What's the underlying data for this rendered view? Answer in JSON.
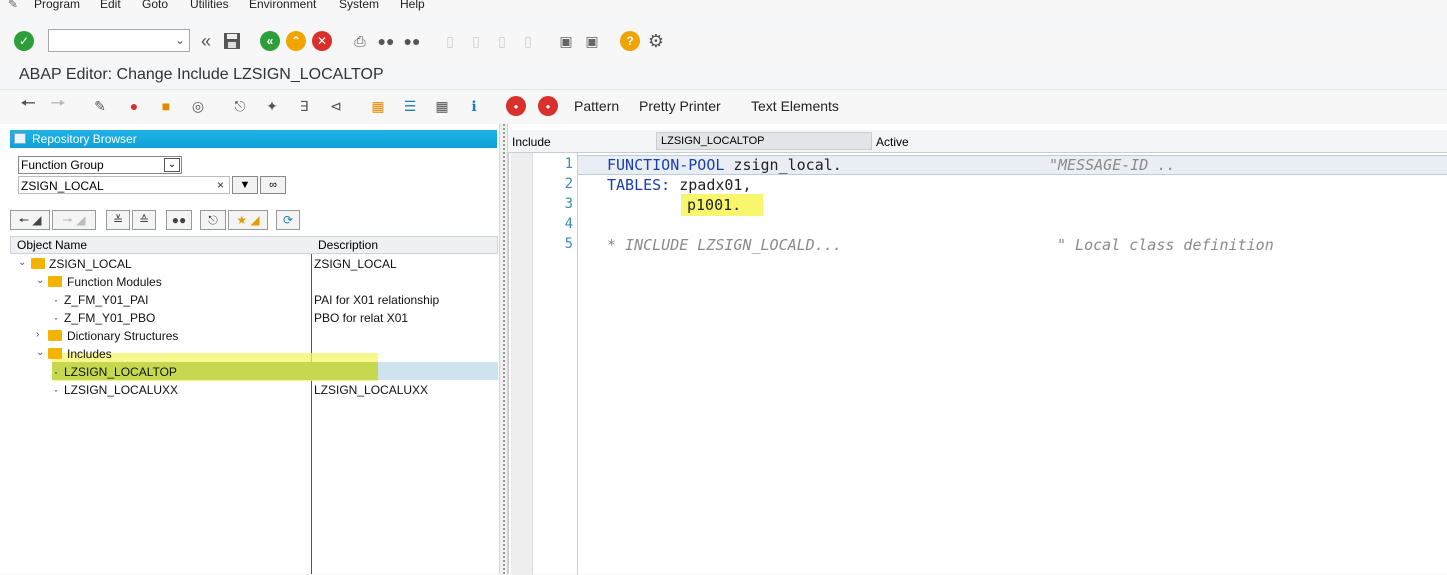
{
  "menu": {
    "items": [
      "Program",
      "Edit",
      "Goto",
      "Utilities",
      "Environment",
      "System",
      "Help"
    ]
  },
  "standard_toolbar": {
    "command_field": {
      "value": "",
      "placeholder": ""
    },
    "icons": [
      "enter-icon",
      "back-icon",
      "save-icon",
      "exit-icon",
      "up-icon",
      "cancel-icon",
      "print-icon",
      "find-icon",
      "find-next-icon",
      "first-page-icon",
      "prev-page-icon",
      "next-page-icon",
      "last-page-icon",
      "new-session-icon",
      "shortcut-icon",
      "help-icon",
      "settings-icon"
    ]
  },
  "title": "ABAP Editor: Change Include LZSIGN_LOCALTOP",
  "app_toolbar": {
    "pattern_label": "Pattern",
    "pretty_printer_label": "Pretty Printer",
    "text_elements_label": "Text Elements"
  },
  "repository": {
    "header": "Repository Browser",
    "object_type": "Function Group",
    "object_name": "ZSIGN_LOCAL",
    "clear_symbol": "×",
    "columns": {
      "name": "Object Name",
      "description": "Description"
    },
    "tree": [
      {
        "name": "ZSIGN_LOCAL",
        "desc": "ZSIGN_LOCAL",
        "level": 0,
        "type": "folder",
        "expanded": true
      },
      {
        "name": "Function Modules",
        "desc": "",
        "level": 1,
        "type": "folder",
        "expanded": true
      },
      {
        "name": "Z_FM_Y01_PAI",
        "desc": "PAI for X01 relationship",
        "level": 2,
        "type": "leaf"
      },
      {
        "name": "Z_FM_Y01_PBO",
        "desc": "PBO for relat X01",
        "level": 2,
        "type": "leaf"
      },
      {
        "name": "Dictionary Structures",
        "desc": "",
        "level": 1,
        "type": "folder",
        "expanded": false
      },
      {
        "name": "Includes",
        "desc": "",
        "level": 1,
        "type": "folder",
        "expanded": true
      },
      {
        "name": "LZSIGN_LOCALTOP",
        "desc": "",
        "level": 2,
        "type": "leaf",
        "selected": true
      },
      {
        "name": "LZSIGN_LOCALUXX",
        "desc": "LZSIGN_LOCALUXX",
        "level": 2,
        "type": "leaf"
      }
    ]
  },
  "editor": {
    "include_label": "Include",
    "include_name": "LZSIGN_LOCALTOP",
    "status": "Active",
    "lines": [
      {
        "num": "1",
        "text": "FUNCTION-POOL zsign_local.",
        "comment": "\"MESSAGE-ID .."
      },
      {
        "num": "2",
        "text": "TABLES: zpadx01,",
        "comment": ""
      },
      {
        "num": "3",
        "text": "p1001.",
        "comment": ""
      },
      {
        "num": "4",
        "text": "",
        "comment": ""
      },
      {
        "num": "5",
        "text": "* INCLUDE LZSIGN_LOCALD...",
        "comment": "\" Local class definition"
      }
    ]
  },
  "colors": {
    "header_blue": "#0fa0d6",
    "keyword_blue": "#1b3db0",
    "highlight_yellow": "#f8f66c",
    "ok_green": "#2e9e3a",
    "cancel_red": "#d9302b",
    "up_orange": "#f0a400"
  }
}
